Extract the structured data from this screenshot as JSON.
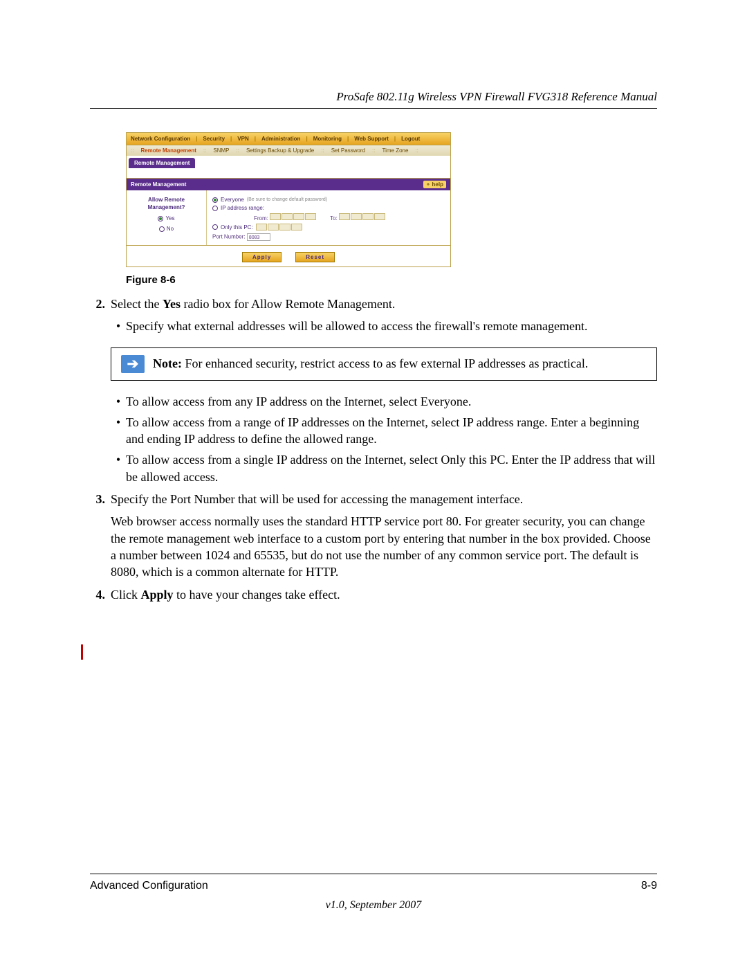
{
  "header": {
    "title": "ProSafe 802.11g Wireless VPN Firewall FVG318 Reference Manual"
  },
  "screenshot": {
    "topbar": {
      "items": [
        "Network Configuration",
        "Security",
        "VPN",
        "Administration",
        "Monitoring",
        "Web Support",
        "Logout"
      ]
    },
    "subtabs": {
      "items": [
        "Remote Management",
        "SNMP",
        "Settings Backup & Upgrade",
        "Set Password",
        "Time Zone"
      ],
      "active_index": 0
    },
    "active_tab": "Remote Management",
    "panel_title": "Remote Management",
    "help_label": "help",
    "left": {
      "question_l1": "Allow Remote",
      "question_l2": "Management?",
      "yes": "Yes",
      "no": "No",
      "selected": "Yes"
    },
    "right": {
      "opt_everyone": "Everyone",
      "opt_everyone_hint": "(Be sure to change default password)",
      "opt_iprange": "IP address range:",
      "from_label": "From:",
      "to_label": "To:",
      "opt_onlypc": "Only this PC:",
      "port_label": "Port Number:",
      "port_value": "8083",
      "selected_opt": "everyone"
    },
    "buttons": {
      "apply": "Apply",
      "reset": "Reset"
    }
  },
  "figure_caption": "Figure 8-6",
  "steps": {
    "s2": {
      "num": "2.",
      "text_pre": "Select the ",
      "bold": "Yes",
      "text_post": " radio box for Allow Remote Management."
    },
    "s2b1": "Specify what external addresses will be allowed to access the firewall's remote management.",
    "note": {
      "label": "Note:",
      "text": " For enhanced security, restrict access to as few external IP addresses as practical."
    },
    "s2b2": "To allow access from any IP address on the Internet, select Everyone.",
    "s2b3": "To allow access from a range of IP addresses on the Internet, select IP address range. Enter a beginning and ending IP address to define the allowed range.",
    "s2b4": "To allow access from a single IP address on the Internet, select Only this PC. Enter the IP address that will be allowed access.",
    "s3": {
      "num": "3.",
      "text": "Specify the Port Number that will be used for accessing the management interface."
    },
    "s3p": "Web browser access normally uses the standard HTTP service port 80. For greater security, you can change the remote management web interface to a custom port by entering that number in the box provided. Choose a number between 1024 and 65535, but do not use the number of any common service port. The default is 8080, which is a common alternate for HTTP.",
    "s4": {
      "num": "4.",
      "text_pre": "Click ",
      "bold": "Apply",
      "text_post": " to have your changes take effect."
    }
  },
  "footer": {
    "section": "Advanced Configuration",
    "page": "8-9",
    "version": "v1.0, September 2007"
  }
}
